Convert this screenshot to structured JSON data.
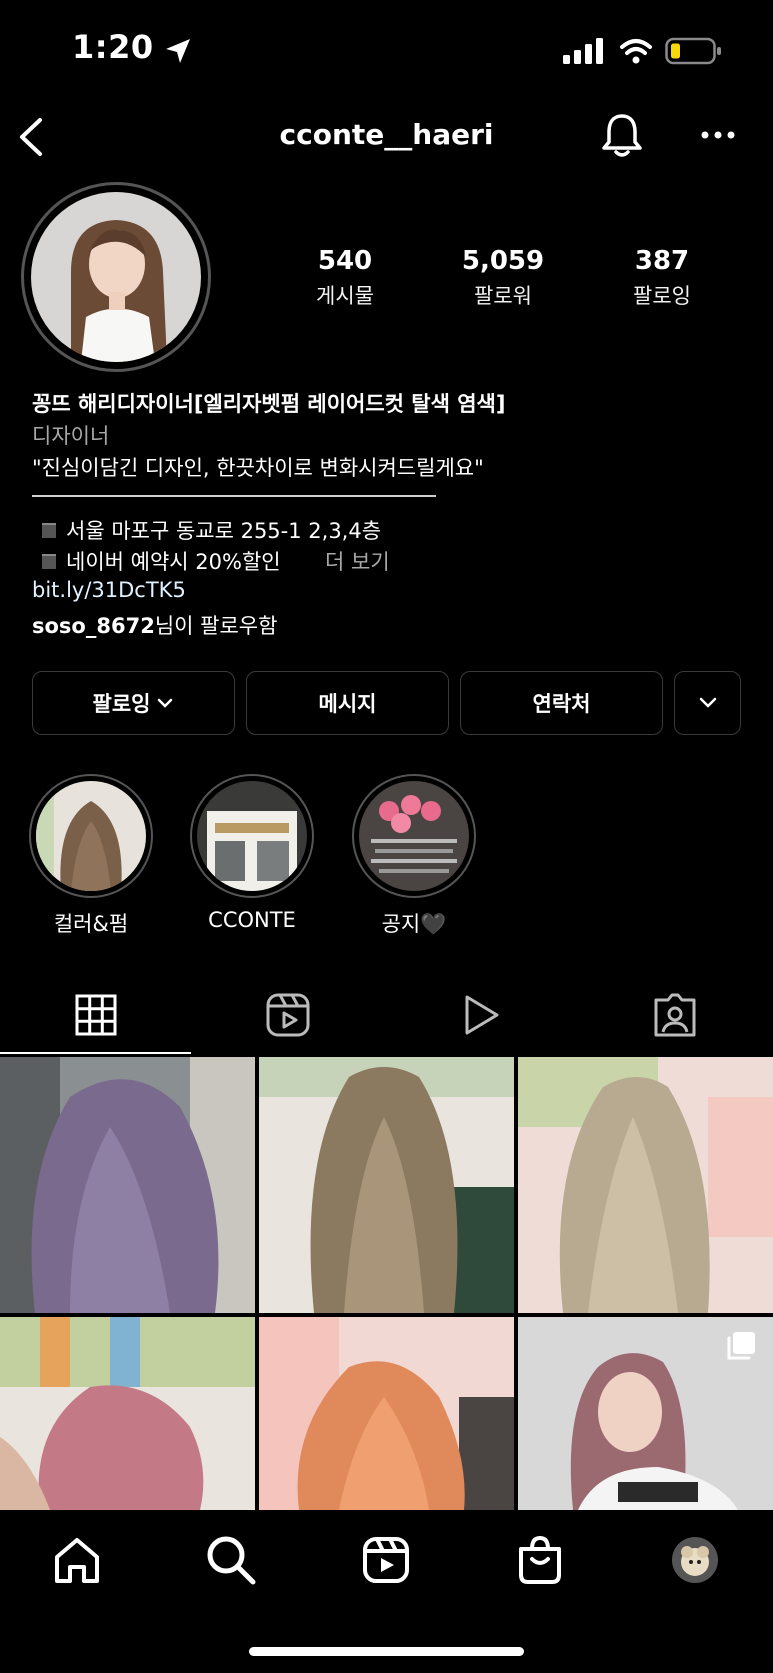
{
  "status_bar": {
    "time": "1:20"
  },
  "header": {
    "username": "cconte__haeri"
  },
  "stats": [
    {
      "value": "540",
      "label": "게시물"
    },
    {
      "value": "5,059",
      "label": "팔로워"
    },
    {
      "value": "387",
      "label": "팔로잉"
    }
  ],
  "bio": {
    "name": "꽁뜨 해리디자이너[엘리자벳펌 레이어드컷 탈색 염색]",
    "category": "디자이너",
    "tagline": "\"진심이담긴 디자인, 한끗차이로 변화시켜드릴게요\"",
    "line_address": "서울 마포구 동교로 255-1 2,3,4층",
    "line_discount": "네이버 예약시 20%할인",
    "more_label": "더 보기",
    "link": "bit.ly/31DcTK5",
    "followed_by_user": "soso_8672",
    "followed_by_suffix": "님이 팔로우함"
  },
  "buttons": {
    "following": "팔로잉",
    "message": "메시지",
    "contact": "연락처"
  },
  "highlights": [
    {
      "label": "컬러&펌"
    },
    {
      "label": "CCONTE"
    },
    {
      "label": "공지🖤"
    }
  ],
  "tabs": [
    "grid-icon",
    "reels-icon",
    "video-icon",
    "tagged-icon"
  ],
  "colors": {
    "background": "#000000",
    "border": "#3a3a3a",
    "muted": "#a8a8a8",
    "battery": "#f5d90a"
  }
}
